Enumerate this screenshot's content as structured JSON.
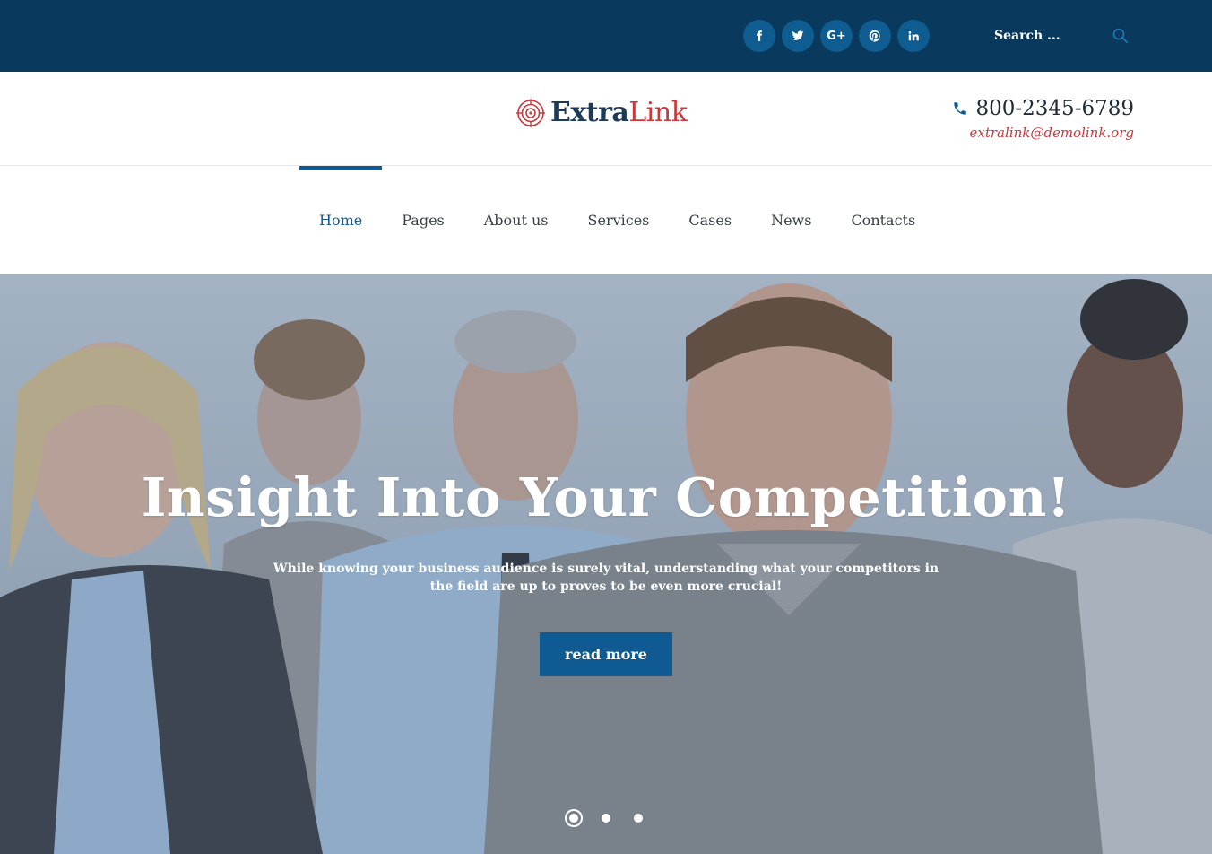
{
  "topbar": {
    "social": [
      {
        "name": "facebook-icon",
        "glyph": "f"
      },
      {
        "name": "twitter-icon",
        "glyph": "t"
      },
      {
        "name": "google-plus-icon",
        "glyph": "G+"
      },
      {
        "name": "pinterest-icon",
        "glyph": "p"
      },
      {
        "name": "linkedin-icon",
        "glyph": "in"
      }
    ],
    "search_placeholder": "Search ..."
  },
  "header": {
    "logo_part1": "Extra",
    "logo_part2": "Link",
    "phone": "800-2345-6789",
    "email": "extralink@demolink.org"
  },
  "nav": {
    "items": [
      {
        "label": "Home"
      },
      {
        "label": "Pages"
      },
      {
        "label": "About us"
      },
      {
        "label": "Services"
      },
      {
        "label": "Cases"
      },
      {
        "label": "News"
      },
      {
        "label": "Contacts"
      }
    ]
  },
  "hero": {
    "title": "Insight Into Your Competition!",
    "text": "While knowing your business audience is surely vital, understanding what your competitors in the field are up to proves to be even more crucial!",
    "button": "read more",
    "slides_active": 1,
    "slides_total": 3
  },
  "colors": {
    "topbar": "#093a5e",
    "accent": "#0f5a92",
    "brand_red": "#c9383a"
  }
}
